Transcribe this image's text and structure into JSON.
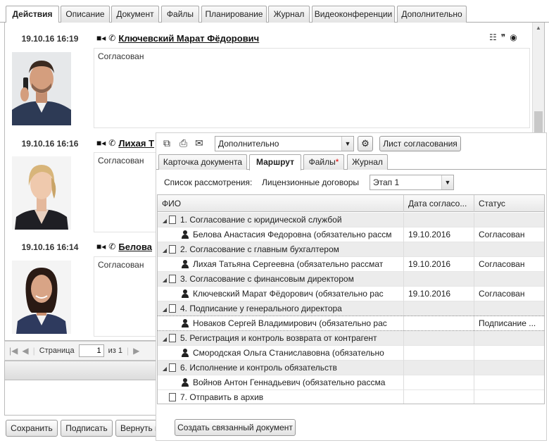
{
  "main_tabs": [
    "Действия",
    "Описание",
    "Документ",
    "Файлы",
    "Планирование",
    "Журнал",
    "Видеоконференции",
    "Дополнительно"
  ],
  "entries": [
    {
      "date": "19.10.16 16:19",
      "name": "Ключевский Марат Фёдорович",
      "comment": "Согласован"
    },
    {
      "date": "19.10.16 16:16",
      "name": "Лихая Т",
      "comment": "Согласован"
    },
    {
      "date": "19.10.16 16:14",
      "name": "Белова",
      "comment": "Согласован"
    }
  ],
  "pager": {
    "label": "Страница",
    "page": "1",
    "of": "из 1"
  },
  "buttons": {
    "save": "Сохранить",
    "sign": "Подписать",
    "return": "Вернуть н"
  },
  "popup": {
    "select_value": "Дополнительно",
    "approval_sheet": "Лист согласования",
    "tabs": [
      {
        "label": "Карточка документа"
      },
      {
        "label": "Маршрут"
      },
      {
        "label": "Файлы",
        "star": "*"
      },
      {
        "label": "Журнал"
      }
    ],
    "route_label": "Список рассмотрения:",
    "route_name": "Лицензионные договоры",
    "stage_value": "Этап 1",
    "columns": [
      "ФИО",
      "Дата согласо...",
      "Статус"
    ],
    "rows": [
      {
        "type": "group",
        "text": "1. Согласование с юридической службой",
        "date": "",
        "status": ""
      },
      {
        "type": "person",
        "text": "Белова Анастасия Федоровна (обязательно рассм",
        "date": "19.10.2016",
        "status": "Согласован"
      },
      {
        "type": "group",
        "text": "2. Согласование с главным бухгалтером",
        "date": "",
        "status": ""
      },
      {
        "type": "person",
        "text": "Лихая Татьяна Сергеевна (обязательно рассмат",
        "date": "19.10.2016",
        "status": "Согласован"
      },
      {
        "type": "group",
        "text": "3. Согласование с финансовым директором",
        "date": "",
        "status": ""
      },
      {
        "type": "person",
        "text": "Ключевский Марат Фёдорович (обязательно рас",
        "date": "19.10.2016",
        "status": "Согласован"
      },
      {
        "type": "group",
        "text": "4. Подписание у генерального директора",
        "date": "",
        "status": ""
      },
      {
        "type": "person",
        "text": "Новаков Сергей Владимирович (обязательно рас",
        "date": "",
        "status": "Подписание ..."
      },
      {
        "type": "group",
        "text": "5. Регистрация и контроль возврата от контрагент",
        "date": "",
        "status": ""
      },
      {
        "type": "person",
        "text": "Смородская Ольга Станиславовна (обязательно",
        "date": "",
        "status": ""
      },
      {
        "type": "group",
        "text": "6. Исполнение и контроль обязательств",
        "date": "",
        "status": ""
      },
      {
        "type": "person",
        "text": "Войнов Антон Геннадьевич (обязательно рассма",
        "date": "",
        "status": ""
      },
      {
        "type": "leaf",
        "text": "7. Отправить в архив",
        "date": "",
        "status": ""
      }
    ],
    "create_linked": "Создать связанный документ"
  }
}
